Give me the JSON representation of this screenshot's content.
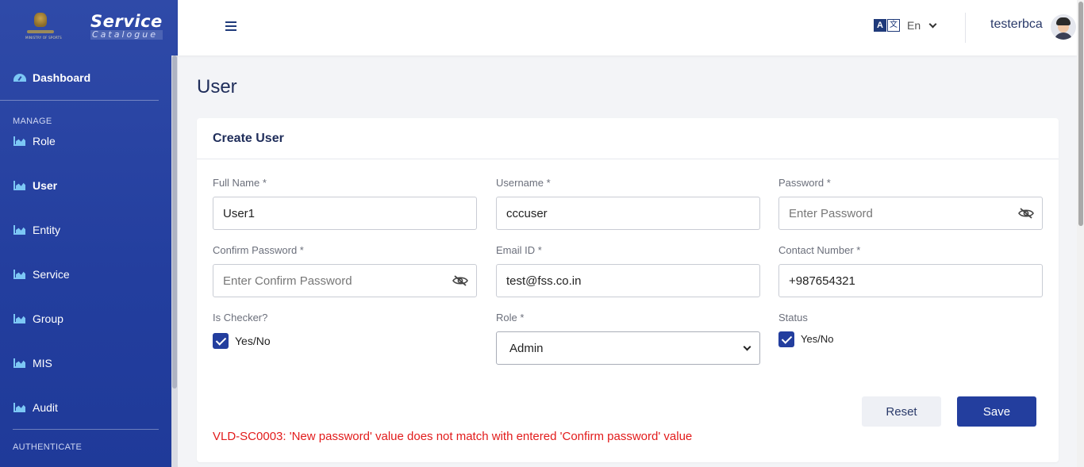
{
  "brand": {
    "emblem_text": "MINISTRY OF SPORTS",
    "title": "Service",
    "subtitle": "Catalogue"
  },
  "sidebar": {
    "dashboard": "Dashboard",
    "manage_section": "MANAGE",
    "items": [
      {
        "label": "Role",
        "active": false
      },
      {
        "label": "User",
        "active": true
      },
      {
        "label": "Entity",
        "active": false
      },
      {
        "label": "Service",
        "active": false
      },
      {
        "label": "Group",
        "active": false
      },
      {
        "label": "MIS",
        "active": false
      },
      {
        "label": "Audit",
        "active": false
      }
    ],
    "authenticate_section": "AUTHENTICATE"
  },
  "topbar": {
    "lang_icon_a": "A",
    "lang_icon_b": "文",
    "language": "En",
    "username": "testerbca"
  },
  "page": {
    "title": "User",
    "card_title": "Create User"
  },
  "form": {
    "full_name": {
      "label": "Full Name *",
      "value": "User1"
    },
    "username": {
      "label": "Username *",
      "value": "cccuser"
    },
    "password": {
      "label": "Password *",
      "placeholder": "Enter Password"
    },
    "confirm_password": {
      "label": "Confirm Password *",
      "placeholder": "Enter Confirm Password"
    },
    "email": {
      "label": "Email ID *",
      "value": "test@fss.co.in"
    },
    "contact": {
      "label": "Contact Number *",
      "value": "+987654321"
    },
    "is_checker": {
      "label": "Is Checker?",
      "option": "Yes/No",
      "checked": true
    },
    "role": {
      "label": "Role *",
      "selected": "Admin"
    },
    "status": {
      "label": "Status",
      "option": "Yes/No",
      "checked": true
    }
  },
  "actions": {
    "reset": "Reset",
    "save": "Save"
  },
  "error": "VLD-SC0003: 'New password' value does not match with entered 'Confirm password' value",
  "colors": {
    "sidebar": "#233e9e",
    "primary": "#233e9e",
    "error": "#e21b1b"
  }
}
